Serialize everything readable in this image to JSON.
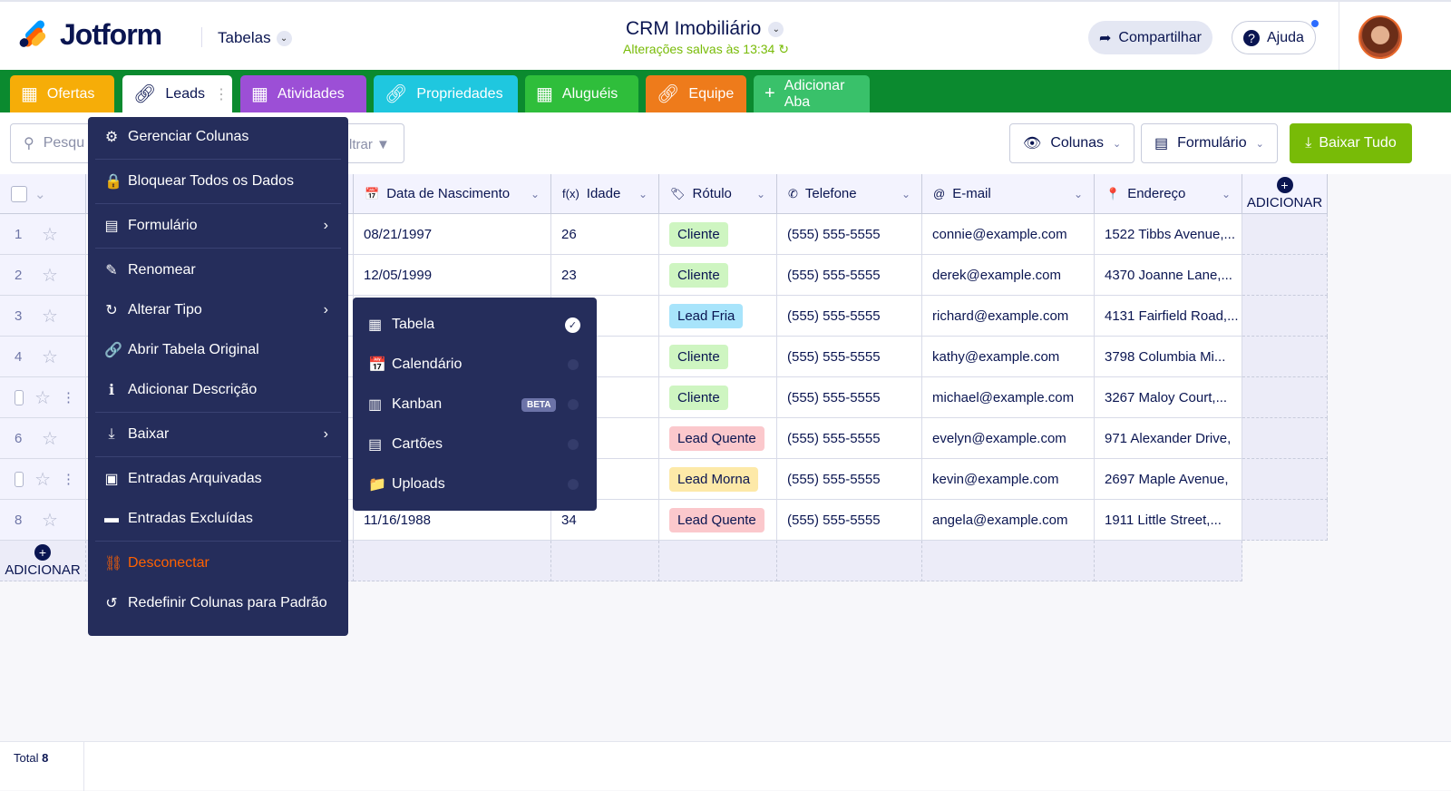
{
  "header": {
    "logo": "Jotform",
    "section": "Tabelas",
    "title": "CRM Imobiliário",
    "saved": "Alterações salvas às 13:34",
    "share": "Compartilhar",
    "help": "Ajuda"
  },
  "tabs": [
    {
      "label": "Ofertas",
      "color": "#f6ad08",
      "icon": "grid"
    },
    {
      "label": "Leads",
      "color": "#ffffff",
      "icon": "link"
    },
    {
      "label": "Atividades",
      "color": "#9c4fd6",
      "icon": "grid"
    },
    {
      "label": "Propriedades",
      "color": "#1fc7df",
      "icon": "link"
    },
    {
      "label": "Aluguéis",
      "color": "#2fbe3b",
      "icon": "grid"
    },
    {
      "label": "Equipe",
      "color": "#ee7b1b",
      "icon": "link"
    },
    {
      "label": "Adicionar Aba",
      "color": "#39c16a",
      "icon": "plus"
    }
  ],
  "toolbar": {
    "search_placeholder": "Pesqu",
    "filter": "ltrar",
    "columns": "Colunas",
    "form": "Formulário",
    "download_all": "Baixar Tudo"
  },
  "columns": [
    "Data de Nascimento",
    "Idade",
    "Rótulo",
    "Telefone",
    "E-mail",
    "Endereço"
  ],
  "add_label": "ADICIONAR",
  "rows": [
    {
      "n": "1",
      "date": "08/21/1997",
      "age": "26",
      "tag": "Cliente",
      "phone": "(555) 555-5555",
      "email": "connie@example.com",
      "addr": "1522 Tibbs Avenue,..."
    },
    {
      "n": "2",
      "date": "12/05/1999",
      "age": "23",
      "tag": "Cliente",
      "phone": "(555) 555-5555",
      "email": "derek@example.com",
      "addr": "4370 Joanne Lane,..."
    },
    {
      "n": "3",
      "date": "",
      "age": "",
      "tag": "Lead Fria",
      "phone": "(555) 555-5555",
      "email": "richard@example.com",
      "addr": "4131 Fairfield Road,..."
    },
    {
      "n": "4",
      "date": "",
      "age": "",
      "tag": "Cliente",
      "phone": "(555) 555-5555",
      "email": "kathy@example.com",
      "addr": "3798 Columbia Mi..."
    },
    {
      "n": "",
      "date": "",
      "age": "",
      "tag": "Cliente",
      "phone": "(555) 555-5555",
      "email": "michael@example.com",
      "addr": "3267 Maloy Court,..."
    },
    {
      "n": "6",
      "date": "",
      "age": "",
      "tag": "Lead Quente",
      "phone": "(555) 555-5555",
      "email": "evelyn@example.com",
      "addr": "971 Alexander Drive,"
    },
    {
      "n": "",
      "date": "",
      "age": "",
      "tag": "Lead Morna",
      "phone": "(555) 555-5555",
      "email": "kevin@example.com",
      "addr": "2697 Maple Avenue,"
    },
    {
      "n": "8",
      "date": "11/16/1988",
      "age": "34",
      "tag": "Lead Quente",
      "phone": "(555) 555-5555",
      "email": "angela@example.com",
      "addr": "1911 Little Street,..."
    }
  ],
  "tag_colors": {
    "Cliente": "#cef5c1",
    "Lead Fria": "#a8e4fb",
    "Lead Quente": "#fbc8cc",
    "Lead Morna": "#fde9a8"
  },
  "menu": [
    {
      "label": "Gerenciar Colunas",
      "icon": "⚙"
    },
    {
      "label": "Bloquear Todos os Dados",
      "icon": "🔒"
    },
    {
      "label": "Formulário",
      "icon": "▤",
      "arrow": true
    },
    {
      "label": "Renomear",
      "icon": "✎"
    },
    {
      "label": "Alterar Tipo",
      "icon": "↻",
      "arrow": true
    },
    {
      "label": "Abrir Tabela Original",
      "icon": "🔗"
    },
    {
      "label": "Adicionar Descrição",
      "icon": "ℹ"
    },
    {
      "label": "Baixar",
      "icon": "⤓",
      "arrow": true
    },
    {
      "label": "Entradas Arquivadas",
      "icon": "▣"
    },
    {
      "label": "Entradas Excluídas",
      "icon": "▬"
    },
    {
      "label": "Desconectar",
      "icon": "⛓",
      "danger": true
    },
    {
      "label": "Redefinir Colunas para Padrão",
      "icon": "↺"
    }
  ],
  "submenu": [
    {
      "label": "Tabela",
      "icon": "▦",
      "checked": true
    },
    {
      "label": "Calendário",
      "icon": "📅"
    },
    {
      "label": "Kanban",
      "icon": "▥",
      "badge": "BETA"
    },
    {
      "label": "Cartões",
      "icon": "▤"
    },
    {
      "label": "Uploads",
      "icon": "📁"
    }
  ],
  "footer": {
    "total_label": "Total",
    "total": "8"
  }
}
